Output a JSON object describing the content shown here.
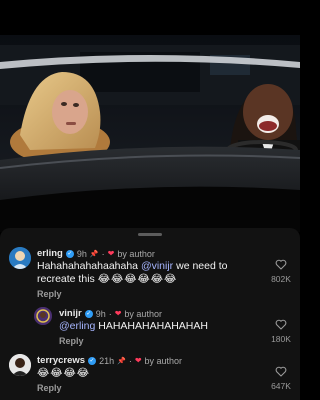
{
  "comments": [
    {
      "username": "erling",
      "time": "9h",
      "by_author": "by author",
      "text_prefix": "Hahahahahahaahaha ",
      "mention": "@vinijr",
      "text_suffix": " we need to recreate this ",
      "emojis": "😂😂😂😂😂😂",
      "reply": "Reply",
      "likes": "802K"
    },
    {
      "username": "vinijr",
      "time": "9h",
      "by_author": "by author",
      "mention": "@erling",
      "text_suffix": " HAHAHAHAHAHAHAH",
      "reply": "Reply",
      "likes": "180K"
    },
    {
      "username": "terrycrews",
      "time": "21h",
      "by_author": "by author",
      "emojis": "😂😂😂😂",
      "reply": "Reply",
      "likes": "647K"
    }
  ],
  "colors": {
    "sheet_bg": "#121212",
    "mention": "#a7b6ff",
    "verified": "#2f9cf5",
    "author_heart": "#ff3b5c"
  },
  "icons": {
    "verified": "verified-badge-icon",
    "heart": "heart-outline-icon",
    "pin": "pin-icon"
  }
}
